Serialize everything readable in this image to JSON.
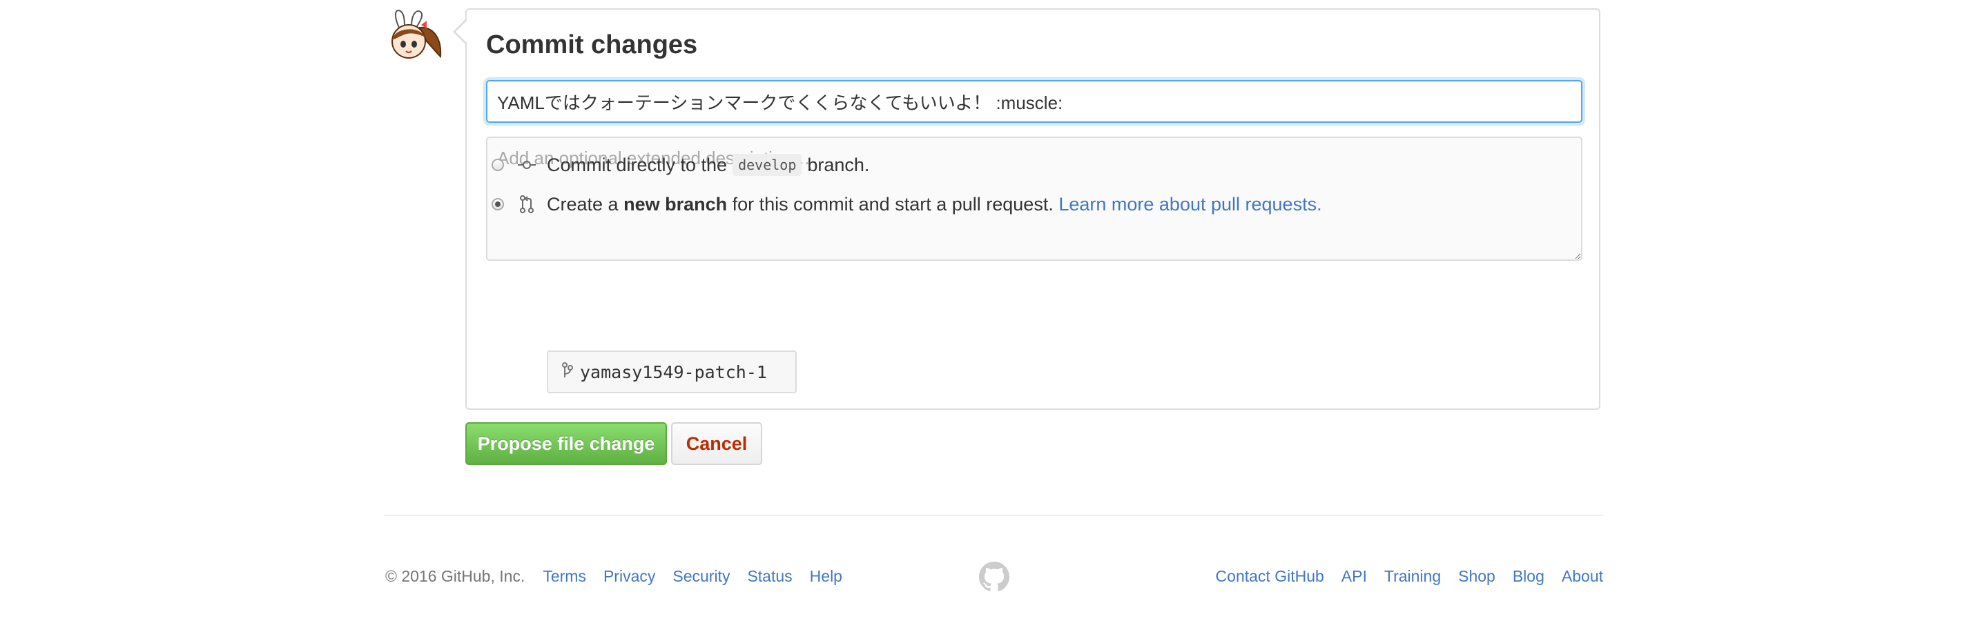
{
  "commit": {
    "title": "Commit changes",
    "summary_value": "YAMLではクォーテーションマークでくくらなくてもいいよ！ :muscle:",
    "description_placeholder": "Add an optional extended description…",
    "option_direct": {
      "prefix": "Commit directly to the",
      "branch": "develop",
      "suffix": "branch.",
      "checked": false
    },
    "option_new_branch": {
      "prefix": "Create a",
      "bold": "new branch",
      "suffix": "for this commit and start a pull request.",
      "link": "Learn more about pull requests.",
      "checked": true
    },
    "new_branch_name": "yamasy1549-patch-1"
  },
  "buttons": {
    "propose": "Propose file change",
    "cancel": "Cancel"
  },
  "footer": {
    "copyright": "© 2016 GitHub, Inc.",
    "left_links": [
      "Terms",
      "Privacy",
      "Security",
      "Status",
      "Help"
    ],
    "right_links": [
      "Contact GitHub",
      "API",
      "Training",
      "Shop",
      "Blog",
      "About"
    ]
  },
  "icons": {
    "avatar": "user-avatar",
    "direct_commit": "git-commit-icon",
    "new_branch": "git-pull-request-icon",
    "branch_input": "git-branch-icon",
    "footer_logo": "github-mark-icon"
  },
  "colors": {
    "link": "#4078c0",
    "primary_button": "#60b044",
    "cancel_text": "#bd2c00",
    "focus_border": "#51a7e8"
  }
}
